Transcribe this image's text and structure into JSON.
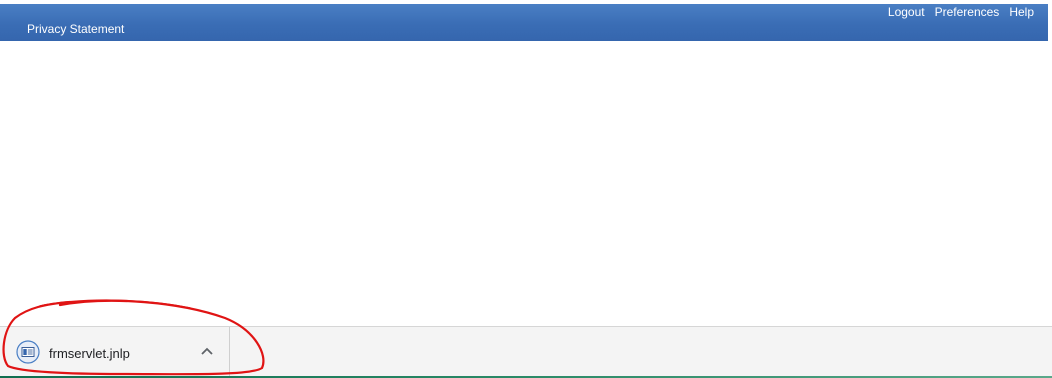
{
  "header": {
    "top_links": [
      "Logout",
      "Preferences",
      "Help"
    ],
    "privacy_label": "Privacy Statement"
  },
  "download_shelf": {
    "file_name": "frmservlet.jnlp",
    "file_icon": "jnlp-file-icon",
    "expand_icon": "chevron-up-icon"
  },
  "colors": {
    "header_blue": "#3a6db5",
    "annotation_red": "#e01414",
    "shelf_accent": "#0f6e4f"
  }
}
